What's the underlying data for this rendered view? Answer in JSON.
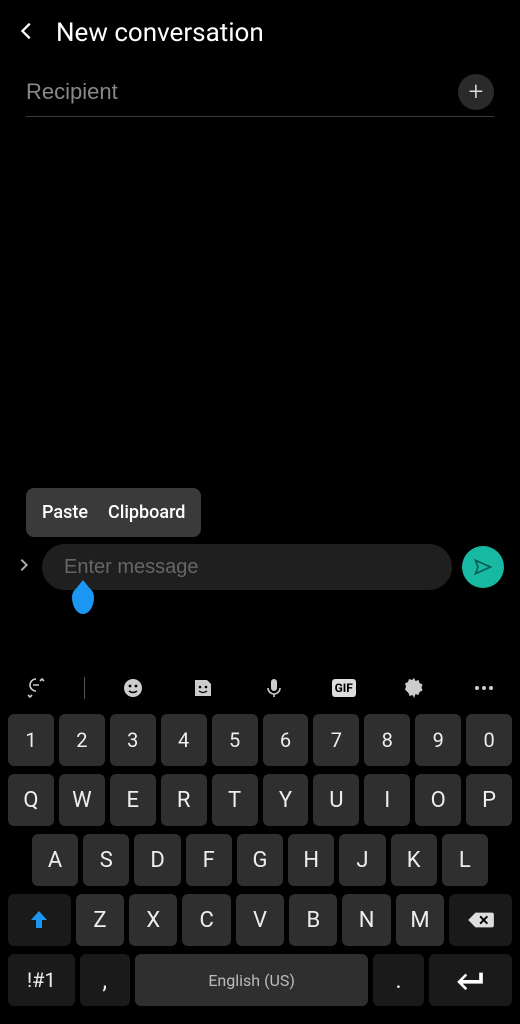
{
  "header": {
    "title": "New conversation"
  },
  "recipient": {
    "placeholder": "Recipient"
  },
  "popup": {
    "paste": "Paste",
    "clipboard": "Clipboard"
  },
  "compose": {
    "placeholder": "Enter message"
  },
  "keyboard": {
    "numRow": [
      "1",
      "2",
      "3",
      "4",
      "5",
      "6",
      "7",
      "8",
      "9",
      "0"
    ],
    "row1": [
      "Q",
      "W",
      "E",
      "R",
      "T",
      "Y",
      "U",
      "I",
      "O",
      "P"
    ],
    "row2": [
      "A",
      "S",
      "D",
      "F",
      "G",
      "H",
      "J",
      "K",
      "L"
    ],
    "row3": [
      "Z",
      "X",
      "C",
      "V",
      "B",
      "N",
      "M"
    ],
    "sym": "!#1",
    "comma": ",",
    "space": "English (US)",
    "period": ".",
    "gif": "GIF"
  },
  "colors": {
    "accent": "#17b9a3",
    "shift": "#1b97f3"
  }
}
